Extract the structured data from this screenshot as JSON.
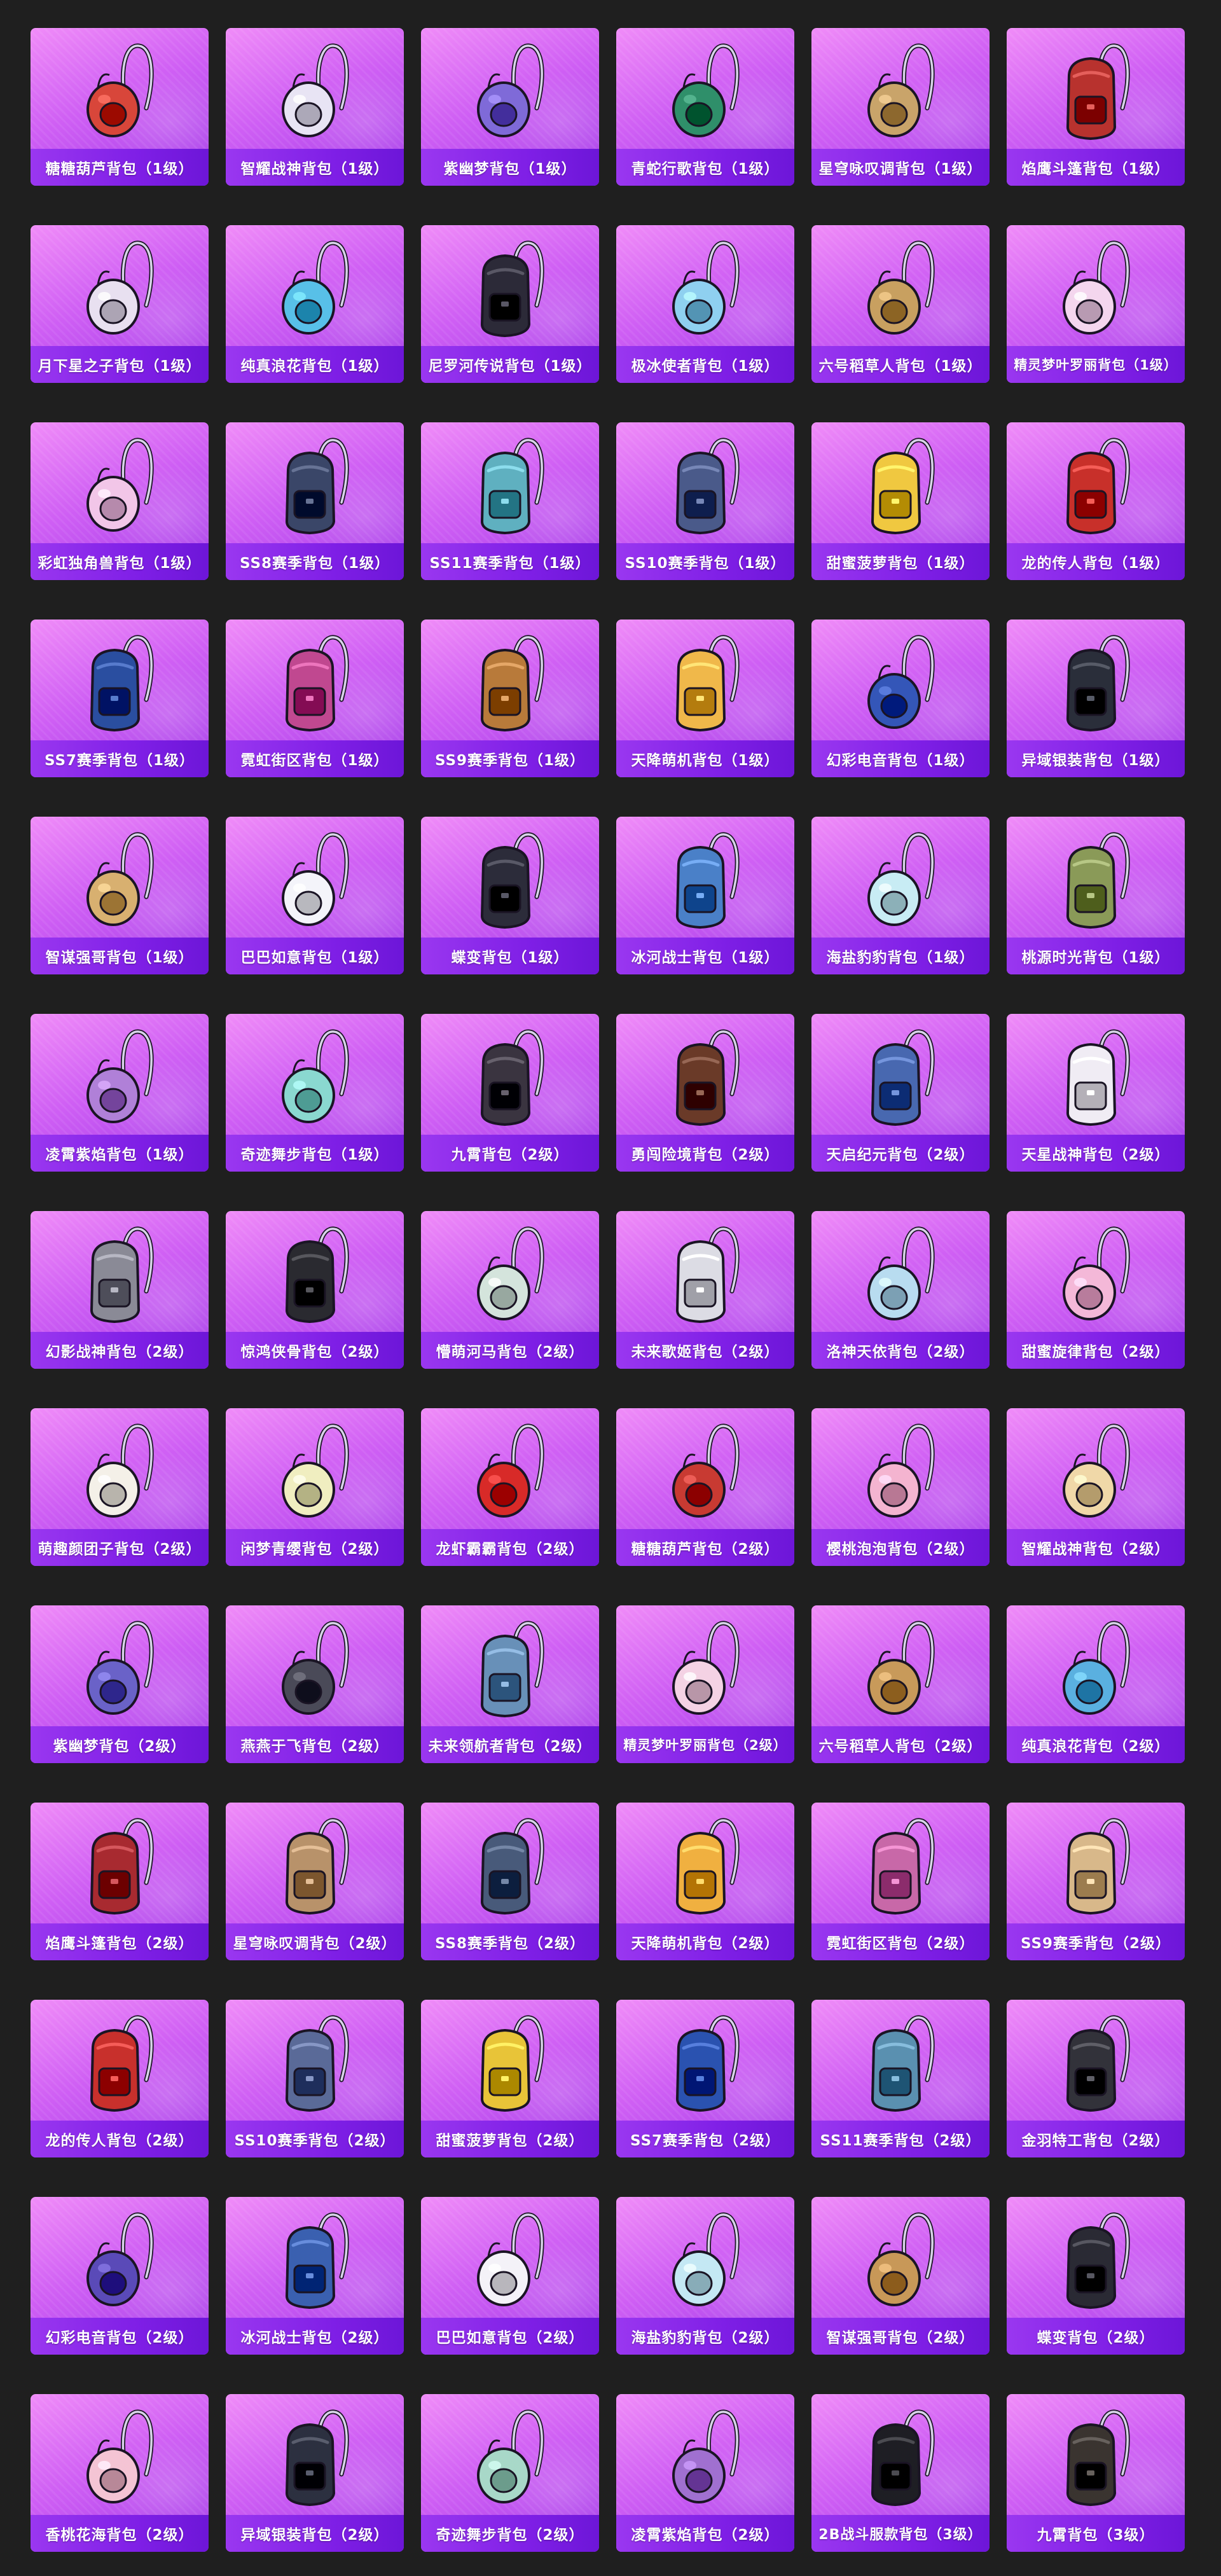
{
  "items": [
    {
      "name": "糖糖葫芦背包（1级）",
      "color": "#d8463a",
      "shape": "round"
    },
    {
      "name": "智耀战神背包（1级）",
      "color": "#e8e4f4",
      "shape": "round"
    },
    {
      "name": "紫幽梦背包（1级）",
      "color": "#7f6ad8",
      "shape": "round"
    },
    {
      "name": "青蛇行歌背包（1级）",
      "color": "#2f8f6a",
      "shape": "round"
    },
    {
      "name": "星穹咏叹调背包（1级）",
      "color": "#c9a46a",
      "shape": "round"
    },
    {
      "name": "焰鹰斗篷背包（1级）",
      "color": "#b8322e",
      "shape": "pack"
    },
    {
      "name": "月下星之子背包（1级）",
      "color": "#e8e0f0",
      "shape": "round"
    },
    {
      "name": "纯真浪花背包（1级）",
      "color": "#58c0e8",
      "shape": "round"
    },
    {
      "name": "尼罗河传说背包（1级）",
      "color": "#2c2a38",
      "shape": "pack"
    },
    {
      "name": "极冰使者背包（1级）",
      "color": "#8fd0f0",
      "shape": "round"
    },
    {
      "name": "六号稻草人背包（1级）",
      "color": "#c8a060",
      "shape": "round"
    },
    {
      "name": "精灵梦叶罗丽背包（1级）",
      "color": "#f4d6ee",
      "shape": "round"
    },
    {
      "name": "彩虹独角兽背包（1级）",
      "color": "#f2c6e8",
      "shape": "round"
    },
    {
      "name": "SS8赛季背包（1级）",
      "color": "#3a4668",
      "shape": "pack"
    },
    {
      "name": "SS11赛季背包（1级）",
      "color": "#5fb0c0",
      "shape": "pack"
    },
    {
      "name": "SS10赛季背包（1级）",
      "color": "#4a5a8a",
      "shape": "pack"
    },
    {
      "name": "甜蜜菠萝背包（1级）",
      "color": "#f0c840",
      "shape": "pack"
    },
    {
      "name": "龙的传人背包（1级）",
      "color": "#c8302a",
      "shape": "pack"
    },
    {
      "name": "SS7赛季背包（1级）",
      "color": "#2a4ea0",
      "shape": "pack"
    },
    {
      "name": "霓虹街区背包（1级）",
      "color": "#c04890",
      "shape": "pack"
    },
    {
      "name": "SS9赛季背包（1级）",
      "color": "#b87a3a",
      "shape": "pack"
    },
    {
      "name": "天降萌机背包（1级）",
      "color": "#f0b84a",
      "shape": "pack"
    },
    {
      "name": "幻彩电音背包（1级）",
      "color": "#3456b8",
      "shape": "round"
    },
    {
      "name": "异域银装背包（1级）",
      "color": "#2a2e3a",
      "shape": "pack"
    },
    {
      "name": "智谋强哥背包（1级）",
      "color": "#d8b070",
      "shape": "round"
    },
    {
      "name": "巴巴如意背包（1级）",
      "color": "#f4f4fa",
      "shape": "round"
    },
    {
      "name": "蝶变背包（1级）",
      "color": "#2c2c3a",
      "shape": "pack"
    },
    {
      "name": "冰河战士背包（1级）",
      "color": "#4a80c8",
      "shape": "pack"
    },
    {
      "name": "海盐豹豹背包（1级）",
      "color": "#c8ecf4",
      "shape": "round"
    },
    {
      "name": "桃源时光背包（1级）",
      "color": "#8a9a58",
      "shape": "pack"
    },
    {
      "name": "凌霄紫焰背包（1级）",
      "color": "#b080d8",
      "shape": "round"
    },
    {
      "name": "奇迹舞步背包（1级）",
      "color": "#8ad8d0",
      "shape": "round"
    },
    {
      "name": "九霄背包（2级）",
      "color": "#3a3440",
      "shape": "pack"
    },
    {
      "name": "勇闯险境背包（2级）",
      "color": "#6a3a28",
      "shape": "pack"
    },
    {
      "name": "天启纪元背包（2级）",
      "color": "#4868b0",
      "shape": "pack"
    },
    {
      "name": "天星战神背包（2级）",
      "color": "#f0ecf4",
      "shape": "pack"
    },
    {
      "name": "幻影战神背包（2级）",
      "color": "#8a8a96",
      "shape": "pack"
    },
    {
      "name": "惊鸿侠骨背包（2级）",
      "color": "#2a2a30",
      "shape": "pack"
    },
    {
      "name": "懵萌河马背包（2级）",
      "color": "#d4e4dc",
      "shape": "round"
    },
    {
      "name": "未来歌姬背包（2级）",
      "color": "#dcdce4",
      "shape": "pack"
    },
    {
      "name": "洛神天依背包（2级）",
      "color": "#b8dcf0",
      "shape": "round"
    },
    {
      "name": "甜蜜旋律背包（2级）",
      "color": "#f4b8d8",
      "shape": "round"
    },
    {
      "name": "萌趣颜团子背包（2级）",
      "color": "#f4f0e8",
      "shape": "round"
    },
    {
      "name": "闲梦青缨背包（2级）",
      "color": "#f0eec0",
      "shape": "round"
    },
    {
      "name": "龙虾霸霸背包（2级）",
      "color": "#d82a28",
      "shape": "round"
    },
    {
      "name": "糖糖葫芦背包（2级）",
      "color": "#c83a32",
      "shape": "round"
    },
    {
      "name": "樱桃泡泡背包（2级）",
      "color": "#f4b4d0",
      "shape": "round"
    },
    {
      "name": "智耀战神背包（2级）",
      "color": "#f0d8a8",
      "shape": "round"
    },
    {
      "name": "紫幽梦背包（2级）",
      "color": "#6a62c8",
      "shape": "round"
    },
    {
      "name": "燕燕于飞背包（2级）",
      "color": "#4a4a58",
      "shape": "round"
    },
    {
      "name": "未来领航者背包（2级）",
      "color": "#6890b8",
      "shape": "pack"
    },
    {
      "name": "精灵梦叶罗丽背包（2级）",
      "color": "#f4d2e4",
      "shape": "round"
    },
    {
      "name": "六号稻草人背包（2级）",
      "color": "#c89a5a",
      "shape": "round"
    },
    {
      "name": "纯真浪花背包（2级）",
      "color": "#5ab0e0",
      "shape": "round"
    },
    {
      "name": "焰鹰斗篷背包（2级）",
      "color": "#a82a30",
      "shape": "pack"
    },
    {
      "name": "星穹咏叹调背包（2级）",
      "color": "#b8926a",
      "shape": "pack"
    },
    {
      "name": "SS8赛季背包（2级）",
      "color": "#485a7a",
      "shape": "pack"
    },
    {
      "name": "天降萌机背包（2级）",
      "color": "#f0b040",
      "shape": "pack"
    },
    {
      "name": "霓虹街区背包（2级）",
      "color": "#c868a8",
      "shape": "pack"
    },
    {
      "name": "SS9赛季背包（2级）",
      "color": "#d8b88a",
      "shape": "pack"
    },
    {
      "name": "龙的传人背包（2级）",
      "color": "#c8302c",
      "shape": "pack"
    },
    {
      "name": "SS10赛季背包（2级）",
      "color": "#5a6a98",
      "shape": "pack"
    },
    {
      "name": "甜蜜菠萝背包（2级）",
      "color": "#e8c438",
      "shape": "pack"
    },
    {
      "name": "SS7赛季背包（2级）",
      "color": "#2a52b0",
      "shape": "pack"
    },
    {
      "name": "SS11赛季背包（2级）",
      "color": "#5a90b0",
      "shape": "pack"
    },
    {
      "name": "金羽特工背包（2级）",
      "color": "#32323a",
      "shape": "pack"
    },
    {
      "name": "幻彩电音背包（2级）",
      "color": "#5a4ab8",
      "shape": "round"
    },
    {
      "name": "冰河战士背包（2级）",
      "color": "#3a60b0",
      "shape": "pack"
    },
    {
      "name": "巴巴如意背包（2级）",
      "color": "#f4f2f8",
      "shape": "round"
    },
    {
      "name": "海盐豹豹背包（2级）",
      "color": "#c4e8f4",
      "shape": "round"
    },
    {
      "name": "智谋强哥背包（2级）",
      "color": "#c89858",
      "shape": "round"
    },
    {
      "name": "蝶变背包（2级）",
      "color": "#2a2a34",
      "shape": "pack"
    },
    {
      "name": "香桃花海背包（2级）",
      "color": "#f4c4d4",
      "shape": "round"
    },
    {
      "name": "异域银装背包（2级）",
      "color": "#2c3040",
      "shape": "pack"
    },
    {
      "name": "奇迹舞步背包（2级）",
      "color": "#a8d8c8",
      "shape": "round"
    },
    {
      "name": "凌霄紫焰背包（2级）",
      "color": "#a070d0",
      "shape": "round"
    },
    {
      "name": "2B战斗服款背包（3级）",
      "color": "#1e1e24",
      "shape": "pack"
    },
    {
      "name": "九霄背包（3级）",
      "color": "#3a3430",
      "shape": "pack"
    }
  ]
}
